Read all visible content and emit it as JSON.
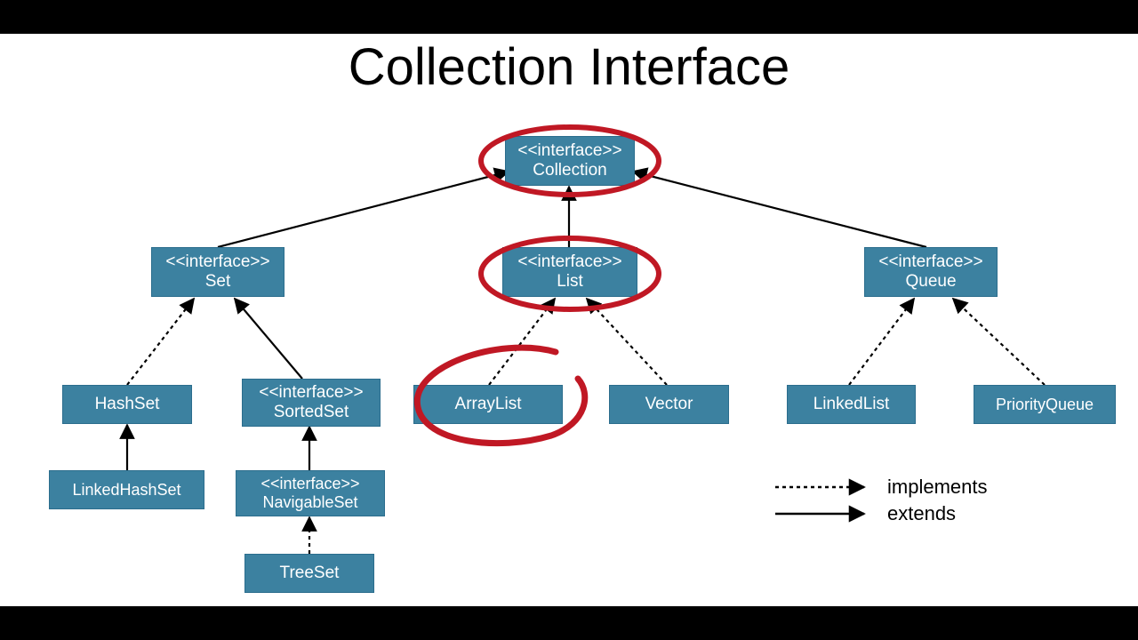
{
  "title": "Collection Interface",
  "stereotype": "<<interface>>",
  "nodes": {
    "collection": {
      "name": "Collection",
      "stereotype": true
    },
    "set": {
      "name": "Set",
      "stereotype": true
    },
    "list": {
      "name": "List",
      "stereotype": true
    },
    "queue": {
      "name": "Queue",
      "stereotype": true
    },
    "hashset": {
      "name": "HashSet",
      "stereotype": false
    },
    "sortedset": {
      "name": "SortedSet",
      "stereotype": true
    },
    "linkedhashset": {
      "name": "LinkedHashSet",
      "stereotype": false
    },
    "navigableset": {
      "name": "NavigableSet",
      "stereotype": true
    },
    "treeset": {
      "name": "TreeSet",
      "stereotype": false
    },
    "arraylist": {
      "name": "ArrayList",
      "stereotype": false
    },
    "vector": {
      "name": "Vector",
      "stereotype": false
    },
    "linkedlist": {
      "name": "LinkedList",
      "stereotype": false
    },
    "priorityqueue": {
      "name": "PriorityQueue",
      "stereotype": false
    }
  },
  "legend": {
    "implements": "implements",
    "extends": "extends"
  },
  "highlights": [
    "collection",
    "list",
    "arraylist"
  ],
  "colors": {
    "node_bg": "#3c81a0",
    "node_fg": "#ffffff",
    "annotation": "#c01824"
  }
}
